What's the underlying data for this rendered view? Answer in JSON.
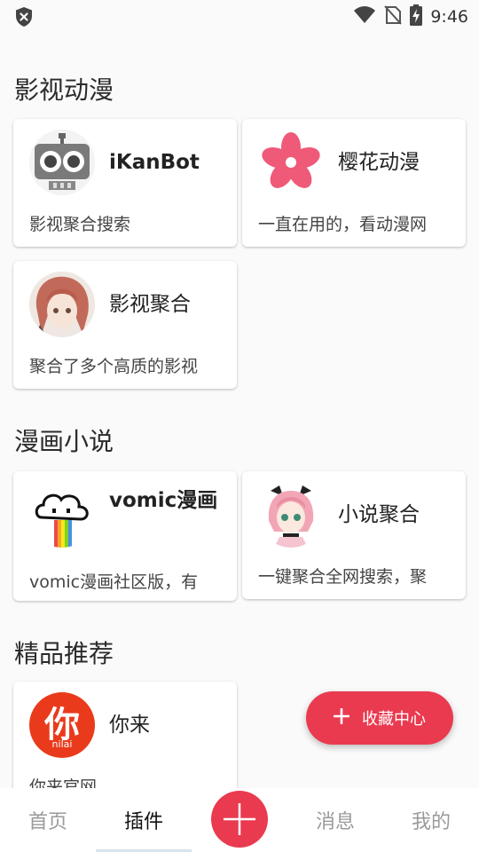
{
  "status_bar": {
    "time": "9:46"
  },
  "sections": [
    {
      "title": "影视动漫",
      "cards": [
        {
          "name": "iKanBot",
          "desc": "影视聚合搜索"
        },
        {
          "name": "樱花动漫",
          "desc": "一直在用的，看动漫网"
        },
        {
          "name": "影视聚合",
          "desc": "聚合了多个高质的影视"
        }
      ]
    },
    {
      "title": "漫画小说",
      "cards": [
        {
          "name": "vomic漫画",
          "desc": "vomic漫画社区版，有"
        },
        {
          "name": "小说聚合",
          "desc": "一键聚合全网搜索，聚"
        }
      ]
    },
    {
      "title": "精品推荐",
      "cards": [
        {
          "name": "你来",
          "desc": "你来官网",
          "logo_text": "你",
          "logo_sub": "nilai"
        }
      ]
    }
  ],
  "fab": {
    "label": "收藏中心"
  },
  "bottom_nav": {
    "items": [
      "首页",
      "插件",
      "消息",
      "我的"
    ],
    "active": "插件"
  },
  "colors": {
    "accent": "#ea3a4f",
    "background": "#fafafa"
  }
}
